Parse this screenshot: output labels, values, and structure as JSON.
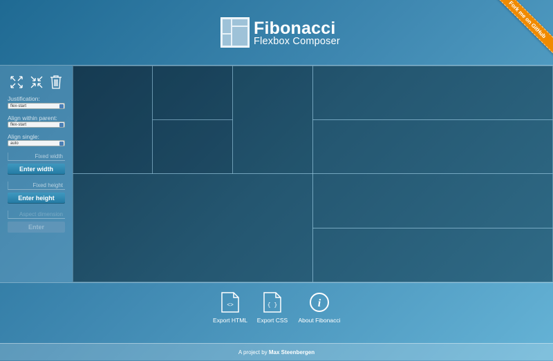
{
  "header": {
    "title": "Fibonacci",
    "subtitle": "Flexbox Composer",
    "ribbon": "Fork me on GitHub"
  },
  "sidebar": {
    "justification_label": "Justification:",
    "justification_value": "flex-start",
    "align_parent_label": "Align within parent:",
    "align_parent_value": "flex-start",
    "align_single_label": "Align single:",
    "align_single_value": "auto",
    "fixed_width_placeholder": "Fixed width",
    "enter_width": "Enter width",
    "fixed_height_placeholder": "Fixed height",
    "enter_height": "Enter height",
    "fixed_ratio_placeholder": "Aspect dimension",
    "enter": "Enter"
  },
  "icons": {
    "expand": "expand-icon",
    "collapse": "collapse-icon",
    "trash": "trash-icon"
  },
  "export": {
    "html": "Export HTML",
    "css": "Export CSS",
    "about": "About Fibonacci"
  },
  "footer": {
    "prefix": "A project by",
    "author": "Max Steenbergen"
  },
  "colors": {
    "accent": "#2a85b0",
    "ribbon": "#f08a00"
  }
}
